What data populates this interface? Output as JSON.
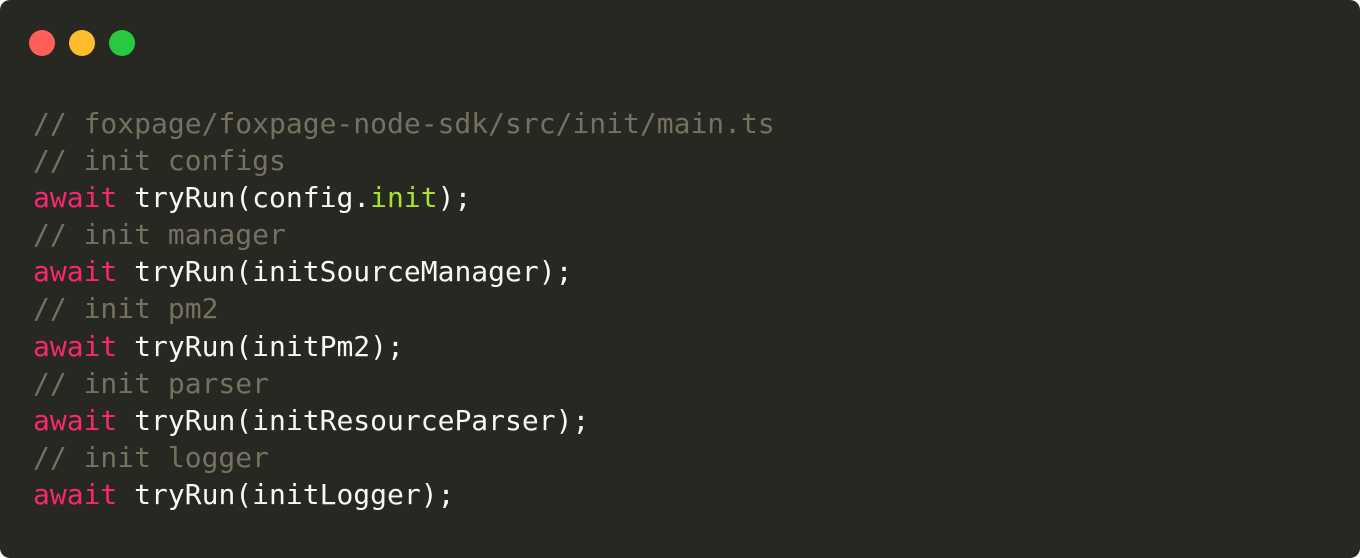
{
  "colors": {
    "background": "#272822",
    "close": "#ff5f56",
    "minimize": "#ffbd2e",
    "maximize": "#27c93f",
    "comment": "#75715e",
    "keyword": "#f92672",
    "property": "#a6e22e",
    "text": "#f8f8f2"
  },
  "window_controls": [
    {
      "name": "close-button",
      "icon": "red-circle"
    },
    {
      "name": "minimize-button",
      "icon": "yellow-circle"
    },
    {
      "name": "maximize-button",
      "icon": "green-circle"
    }
  ],
  "code": {
    "language": "typescript",
    "lines": [
      {
        "comment": "// foxpage/foxpage-node-sdk/src/init/main.ts"
      },
      {
        "comment": "// init configs"
      },
      {
        "kw": "await",
        "pre": " tryRun(config.",
        "prop": "init",
        "post": ");"
      },
      {
        "comment": "// init manager"
      },
      {
        "kw": "await",
        "pre": " tryRun(initSourceManager);"
      },
      {
        "comment": "// init pm2"
      },
      {
        "kw": "await",
        "pre": " tryRun(initPm2);"
      },
      {
        "comment": "// init parser"
      },
      {
        "kw": "await",
        "pre": " tryRun(initResourceParser);"
      },
      {
        "comment": "// init logger"
      },
      {
        "kw": "await",
        "pre": " tryRun(initLogger);"
      }
    ]
  }
}
